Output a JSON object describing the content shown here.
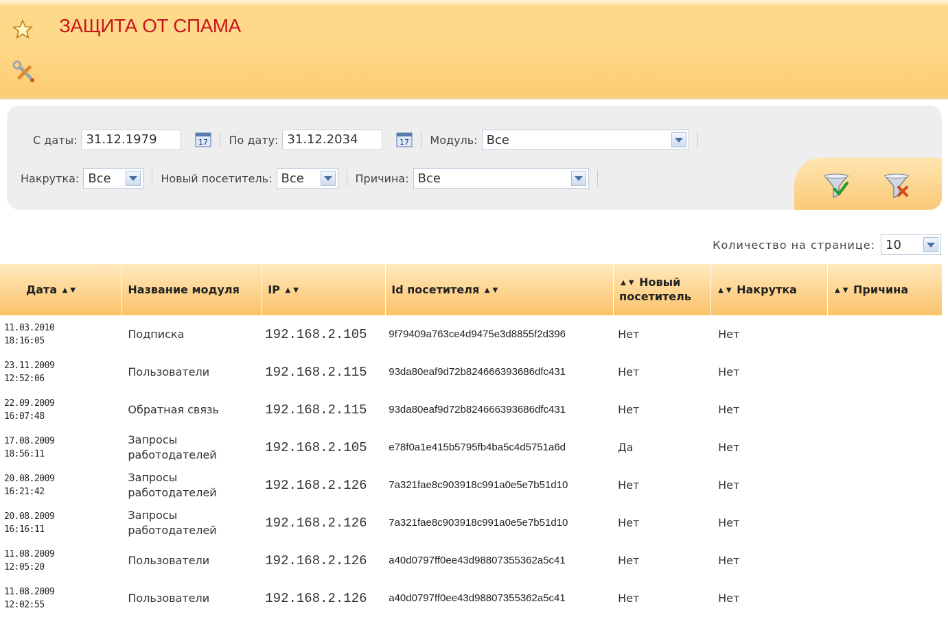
{
  "header": {
    "title": "ЗАЩИТА ОТ СПАМА",
    "star_icon": "star-icon",
    "tools_icon": "tools-icon"
  },
  "filters": {
    "date_from_label": "С даты:",
    "date_from_value": "31.12.1979",
    "date_to_label": "По дату:",
    "date_to_value": "31.12.2034",
    "module_label": "Модуль:",
    "module_value": "Все",
    "cheat_label": "Накрутка:",
    "cheat_value": "Все",
    "new_visitor_label": "Новый посетитель:",
    "new_visitor_value": "Все",
    "reason_label": "Причина:",
    "reason_value": "Все"
  },
  "per_page": {
    "label": "Количество на странице:",
    "value": "10"
  },
  "table": {
    "columns": [
      "Дата",
      "Название модуля",
      "IP",
      "Id посетителя",
      "Новый посетитель",
      "Накрутка",
      "Причина"
    ],
    "rows": [
      {
        "date": "11.03.2010",
        "time": "18:16:05",
        "module": "Подписка",
        "ip": "192.168.2.105",
        "id": "9f79409a763ce4d9475e3d8855f2d396",
        "new": "Нет",
        "cheat": "Нет",
        "reason": ""
      },
      {
        "date": "23.11.2009",
        "time": "12:52:06",
        "module": "Пользователи",
        "ip": "192.168.2.115",
        "id": "93da80eaf9d72b824666393686dfc431",
        "new": "Нет",
        "cheat": "Нет",
        "reason": ""
      },
      {
        "date": "22.09.2009",
        "time": "16:07:48",
        "module": "Обратная связь",
        "ip": "192.168.2.115",
        "id": "93da80eaf9d72b824666393686dfc431",
        "new": "Нет",
        "cheat": "Нет",
        "reason": ""
      },
      {
        "date": "17.08.2009",
        "time": "18:56:11",
        "module": "Запросы работодателей",
        "ip": "192.168.2.105",
        "id": "e78f0a1e415b5795fb4ba5c4d5751a6d",
        "new": "Да",
        "cheat": "Нет",
        "reason": ""
      },
      {
        "date": "20.08.2009",
        "time": "16:21:42",
        "module": "Запросы работодателей",
        "ip": "192.168.2.126",
        "id": "7a321fae8c903918c991a0e5e7b51d10",
        "new": "Нет",
        "cheat": "Нет",
        "reason": ""
      },
      {
        "date": "20.08.2009",
        "time": "16:16:11",
        "module": "Запросы работодателей",
        "ip": "192.168.2.126",
        "id": "7a321fae8c903918c991a0e5e7b51d10",
        "new": "Нет",
        "cheat": "Нет",
        "reason": ""
      },
      {
        "date": "11.08.2009",
        "time": "12:05:20",
        "module": "Пользователи",
        "ip": "192.168.2.126",
        "id": "a40d0797ff0ee43d98807355362a5c41",
        "new": "Нет",
        "cheat": "Нет",
        "reason": ""
      },
      {
        "date": "11.08.2009",
        "time": "12:02:55",
        "module": "Пользователи",
        "ip": "192.168.2.126",
        "id": "a40d0797ff0ee43d98807355362a5c41",
        "new": "Нет",
        "cheat": "Нет",
        "reason": ""
      }
    ]
  }
}
